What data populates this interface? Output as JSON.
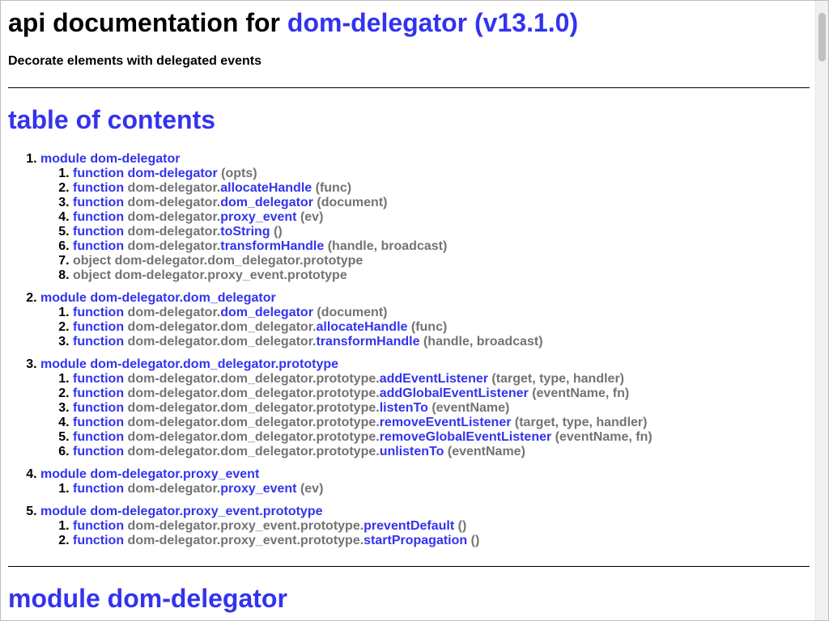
{
  "header": {
    "title_prefix": "api documentation for",
    "package_link": "dom-delegator (v13.1.0)",
    "subtitle": "Decorate elements with delegated events"
  },
  "toc": {
    "heading": "table of contents",
    "modules": [
      {
        "label": "module dom-delegator",
        "items": [
          {
            "kind": "function",
            "prefix": "",
            "name": "dom-delegator",
            "args": "(opts)"
          },
          {
            "kind": "function",
            "prefix": "dom-delegator.",
            "name": "allocateHandle",
            "args": "(func)"
          },
          {
            "kind": "function",
            "prefix": "dom-delegator.",
            "name": "dom_delegator",
            "args": "(document)"
          },
          {
            "kind": "function",
            "prefix": "dom-delegator.",
            "name": "proxy_event",
            "args": "(ev)"
          },
          {
            "kind": "function",
            "prefix": "dom-delegator.",
            "name": "toString",
            "args": "()"
          },
          {
            "kind": "function",
            "prefix": "dom-delegator.",
            "name": "transformHandle",
            "args": "(handle, broadcast)"
          },
          {
            "kind": "object",
            "text": "object dom-delegator.dom_delegator.prototype"
          },
          {
            "kind": "object",
            "text": "object dom-delegator.proxy_event.prototype"
          }
        ]
      },
      {
        "label": "module dom-delegator.dom_delegator",
        "items": [
          {
            "kind": "function",
            "prefix": "dom-delegator.",
            "name": "dom_delegator",
            "args": "(document)"
          },
          {
            "kind": "function",
            "prefix": "dom-delegator.dom_delegator.",
            "name": "allocateHandle",
            "args": "(func)"
          },
          {
            "kind": "function",
            "prefix": "dom-delegator.dom_delegator.",
            "name": "transformHandle",
            "args": "(handle, broadcast)"
          }
        ]
      },
      {
        "label": "module dom-delegator.dom_delegator.prototype",
        "items": [
          {
            "kind": "function",
            "prefix": "dom-delegator.dom_delegator.prototype.",
            "name": "addEventListener",
            "args": "(target, type, handler)"
          },
          {
            "kind": "function",
            "prefix": "dom-delegator.dom_delegator.prototype.",
            "name": "addGlobalEventListener",
            "args": "(eventName, fn)"
          },
          {
            "kind": "function",
            "prefix": "dom-delegator.dom_delegator.prototype.",
            "name": "listenTo",
            "args": "(eventName)"
          },
          {
            "kind": "function",
            "prefix": "dom-delegator.dom_delegator.prototype.",
            "name": "removeEventListener",
            "args": "(target, type, handler)"
          },
          {
            "kind": "function",
            "prefix": "dom-delegator.dom_delegator.prototype.",
            "name": "removeGlobalEventListener",
            "args": "(eventName, fn)"
          },
          {
            "kind": "function",
            "prefix": "dom-delegator.dom_delegator.prototype.",
            "name": "unlistenTo",
            "args": "(eventName)"
          }
        ]
      },
      {
        "label": "module dom-delegator.proxy_event",
        "items": [
          {
            "kind": "function",
            "prefix": "dom-delegator.",
            "name": "proxy_event",
            "args": "(ev)"
          }
        ]
      },
      {
        "label": "module dom-delegator.proxy_event.prototype",
        "items": [
          {
            "kind": "function",
            "prefix": "dom-delegator.proxy_event.prototype.",
            "name": "preventDefault",
            "args": "()"
          },
          {
            "kind": "function",
            "prefix": "dom-delegator.proxy_event.prototype.",
            "name": "startPropagation",
            "args": "()"
          }
        ]
      }
    ]
  },
  "next_section": {
    "heading": "module dom-delegator"
  }
}
